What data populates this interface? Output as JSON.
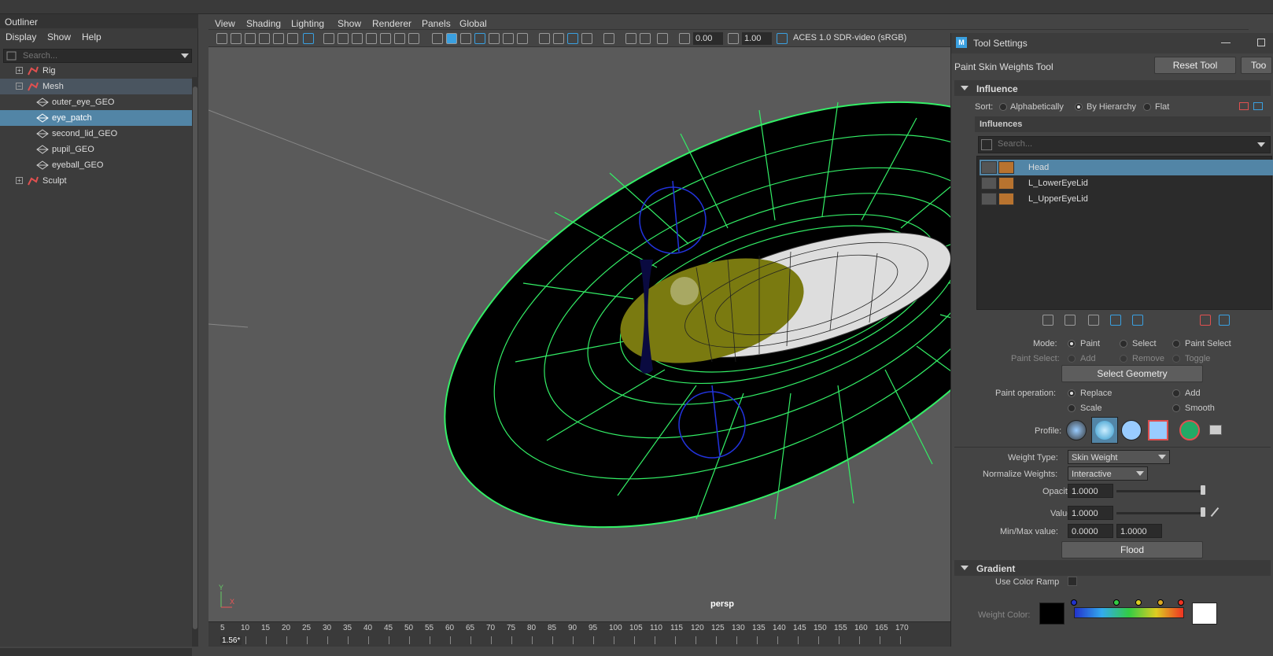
{
  "outliner": {
    "title": "Outliner",
    "menu": [
      "Display",
      "Show",
      "Help"
    ],
    "search_placeholder": "Search...",
    "items": [
      {
        "label": "Rig",
        "expander": "+"
      },
      {
        "label": "Mesh",
        "expander": "−"
      },
      {
        "label": "outer_eye_GEO"
      },
      {
        "label": "eye_patch"
      },
      {
        "label": "second_lid_GEO"
      },
      {
        "label": "pupil_GEO"
      },
      {
        "label": "eyeball_GEO"
      },
      {
        "label": "Sculpt",
        "expander": "+"
      }
    ]
  },
  "viewport": {
    "menu": [
      "View",
      "Shading",
      "Lighting",
      "Show",
      "Renderer",
      "Panels",
      "Global"
    ],
    "exposure": "0.00",
    "gamma": "1.00",
    "color_space": "ACES 1.0 SDR-video (sRGB)",
    "camera_label": "persp",
    "axis_y": "Y",
    "axis_x": "X"
  },
  "timeline": {
    "ticks": [
      "5",
      "10",
      "15",
      "20",
      "25",
      "30",
      "35",
      "40",
      "45",
      "50",
      "55",
      "60",
      "65",
      "70",
      "75",
      "80",
      "85",
      "90",
      "95",
      "100",
      "105",
      "110",
      "115",
      "120",
      "125",
      "130",
      "135",
      "140",
      "145",
      "150",
      "155",
      "160",
      "165",
      "170"
    ],
    "current_frame": "1.56*"
  },
  "tool_settings": {
    "window_title": "Tool Settings",
    "tool_name": "Paint Skin Weights Tool",
    "reset_label": "Reset Tool",
    "tool_help_label": "Too",
    "influence_section": "Influence",
    "sort_label": "Sort:",
    "sort_options": [
      "Alphabetically",
      "By Hierarchy",
      "Flat"
    ],
    "influences_label": "Influences",
    "influence_search_placeholder": "Search...",
    "influences": [
      {
        "name": "Head",
        "color": "#b8732f"
      },
      {
        "name": "L_LowerEyeLid",
        "color": "#b8732f"
      },
      {
        "name": "L_UpperEyeLid",
        "color": "#b8732f"
      }
    ],
    "mode_label": "Mode:",
    "mode_options": [
      "Paint",
      "Select",
      "Paint Select"
    ],
    "paint_select_label": "Paint Select:",
    "paint_select_options": [
      "Add",
      "Remove",
      "Toggle"
    ],
    "select_geometry": "Select Geometry",
    "paint_operation_label": "Paint operation:",
    "paint_operations": [
      "Replace",
      "Add",
      "Scale",
      "Smooth"
    ],
    "profile_label": "Profile:",
    "weight_type_label": "Weight Type:",
    "weight_type_value": "Skin Weight",
    "normalize_label": "Normalize Weights:",
    "normalize_value": "Interactive",
    "opacity_label": "Opacity:",
    "opacity_value": "1.0000",
    "opacity_level": 1.0,
    "value_label": "Value:",
    "value_value": "1.0000",
    "value_level": 1.0,
    "minmax_label": "Min/Max value:",
    "min_value": "0.0000",
    "max_value": "1.0000",
    "flood_label": "Flood",
    "gradient_section": "Gradient",
    "use_color_ramp_label": "Use Color Ramp",
    "weight_color_label": "Weight Color:"
  },
  "colors": {
    "wireframe": "#33ee66",
    "selection": "#5285a6",
    "eyeball_yellow": "#7a7a10"
  }
}
